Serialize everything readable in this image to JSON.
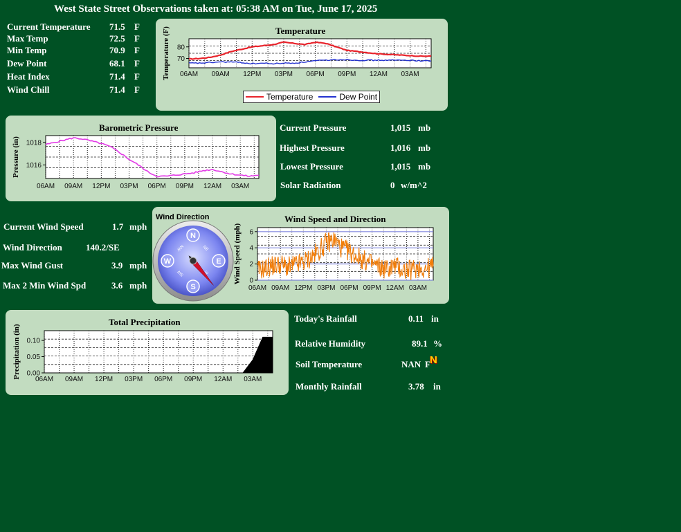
{
  "header": {
    "title": "West State Street Observations taken at: 05:38 AM on Tue, June 17, 2025"
  },
  "temperature_stats": [
    {
      "label": "Current Temperature",
      "value": "71.5",
      "unit": "F"
    },
    {
      "label": "Max Temp",
      "value": "72.5",
      "unit": "F"
    },
    {
      "label": "Min Temp",
      "value": "70.9",
      "unit": "F"
    },
    {
      "label": "Dew Point",
      "value": "68.1",
      "unit": "F"
    },
    {
      "label": "Heat Index",
      "value": "71.4",
      "unit": "F"
    },
    {
      "label": "Wind Chill",
      "value": "71.4",
      "unit": "F"
    }
  ],
  "pressure_stats": [
    {
      "label": "Current Pressure",
      "value": "1,015",
      "unit": "mb"
    },
    {
      "label": "Highest Pressure",
      "value": "1,016",
      "unit": "mb"
    },
    {
      "label": "Lowest Pressure",
      "value": "1,015",
      "unit": "mb"
    },
    {
      "label": "Solar Radiation",
      "value": "0",
      "unit": "w/m^2"
    }
  ],
  "wind_stats": [
    {
      "label": "Current Wind Speed",
      "value": "1.7",
      "unit": "mph"
    },
    {
      "label": "Wind Direction",
      "value": "140.2/SE",
      "unit": ""
    },
    {
      "label": "Max Wind Gust",
      "value": "3.9",
      "unit": "mph"
    },
    {
      "label": "Max 2 Min Wind Spd",
      "value": "3.6",
      "unit": "mph"
    }
  ],
  "misc_stats": [
    {
      "label": "Today's Rainfall",
      "value": "0.11",
      "unit": "in"
    },
    {
      "label": "Relative Humidity",
      "value": "89.1",
      "unit": "%"
    },
    {
      "label": "Soil Temperature",
      "value": "NAN",
      "unit": "F"
    },
    {
      "label": "Monthly Rainfall",
      "value": "3.78",
      "unit": "in"
    }
  ],
  "soil_badge": "N",
  "compass": {
    "title": "Wind Direction",
    "direction_deg": 140.2,
    "cardinals": [
      "N",
      "E",
      "S",
      "W"
    ],
    "intercardinals": [
      "NE",
      "SE",
      "SW",
      "NW"
    ]
  },
  "colors": {
    "background": "#005124",
    "panel": "#c2dcc0",
    "temperature": "#e8242c",
    "dew_point": "#2432d0",
    "pressure": "#e23be6",
    "wind": "#f07d0a",
    "precip": "#000000"
  },
  "time_ticks": [
    "06AM",
    "09AM",
    "12PM",
    "03PM",
    "06PM",
    "09PM",
    "12AM",
    "03AM"
  ],
  "chart_data": [
    {
      "id": "temperature",
      "type": "line",
      "title": "Temperature",
      "ylabel": "Temperature (F)",
      "ylim": [
        62,
        87
      ],
      "yticks": [
        70,
        80
      ],
      "x": [
        "06AM",
        "07AM",
        "08AM",
        "09AM",
        "10AM",
        "11AM",
        "12PM",
        "01PM",
        "02PM",
        "03PM",
        "04PM",
        "05PM",
        "06PM",
        "07PM",
        "08PM",
        "09PM",
        "10PM",
        "11PM",
        "12AM",
        "01AM",
        "02AM",
        "03AM",
        "04AM",
        "05AM"
      ],
      "series": [
        {
          "name": "Temperature",
          "values": [
            69.5,
            70,
            71,
            73,
            76,
            78,
            80,
            81,
            82,
            84,
            83,
            82,
            84,
            83,
            80,
            77,
            76,
            75,
            74,
            73.5,
            73,
            72.5,
            72,
            72
          ]
        },
        {
          "name": "Dew Point",
          "values": [
            66,
            66,
            66.5,
            67,
            67,
            66.5,
            65.5,
            66,
            65.5,
            66,
            66,
            67,
            68,
            68.5,
            69,
            69,
            68.5,
            68.5,
            68.5,
            68.5,
            68.5,
            68.5,
            68,
            68
          ]
        }
      ],
      "legend": "bottom",
      "grid": true
    },
    {
      "id": "pressure",
      "type": "line",
      "title": "Barometric Pressure",
      "ylabel": "Pressure (in)",
      "ylim": [
        1014.8,
        1018.6
      ],
      "yticks": [
        1016,
        1018
      ],
      "x": [
        "06AM",
        "07AM",
        "08AM",
        "09AM",
        "10AM",
        "11AM",
        "12PM",
        "01PM",
        "02PM",
        "03PM",
        "04PM",
        "05PM",
        "06PM",
        "07PM",
        "08PM",
        "09PM",
        "10PM",
        "11PM",
        "12AM",
        "01AM",
        "02AM",
        "03AM",
        "04AM",
        "05AM"
      ],
      "series": [
        {
          "name": "Pressure",
          "values": [
            1017.8,
            1018.0,
            1018.2,
            1018.4,
            1018.3,
            1018.1,
            1017.9,
            1017.6,
            1017.1,
            1016.5,
            1016.0,
            1015.4,
            1015.0,
            1015.0,
            1015.1,
            1015.2,
            1015.3,
            1015.5,
            1015.6,
            1015.4,
            1015.2,
            1015.1,
            1015.0,
            1015.1
          ]
        }
      ],
      "grid": true
    },
    {
      "id": "wind",
      "type": "line",
      "title": "Wind Speed and Direction",
      "ylabel": "Wind Speed (mph)",
      "ylim": [
        0,
        6.5
      ],
      "yticks": [
        0,
        2,
        4,
        6
      ],
      "x": [
        "06AM",
        "07AM",
        "08AM",
        "09AM",
        "10AM",
        "11AM",
        "12PM",
        "01PM",
        "02PM",
        "03PM",
        "04PM",
        "05PM",
        "06PM",
        "07PM",
        "08PM",
        "09PM",
        "10PM",
        "11PM",
        "12AM",
        "01AM",
        "02AM",
        "03AM",
        "04AM",
        "05AM"
      ],
      "series": [
        {
          "name": "Wind Speed",
          "values": [
            1.2,
            1.5,
            1.8,
            2.0,
            1.6,
            1.9,
            2.2,
            2.8,
            3.6,
            4.6,
            5.0,
            4.0,
            3.5,
            3.0,
            2.4,
            2.0,
            1.6,
            1.4,
            1.8,
            1.3,
            1.2,
            1.6,
            1.4,
            1.7
          ]
        }
      ],
      "grid": true
    },
    {
      "id": "precip",
      "type": "area",
      "title": "Total Precipitation",
      "ylabel": "Precipitation (in)",
      "ylim": [
        0,
        0.13
      ],
      "yticks": [
        0.0,
        0.05,
        0.1
      ],
      "ytick_labels": [
        "0.00",
        "0.05",
        "0.10"
      ],
      "x": [
        "06AM",
        "07AM",
        "08AM",
        "09AM",
        "10AM",
        "11AM",
        "12PM",
        "01PM",
        "02PM",
        "03PM",
        "04PM",
        "05PM",
        "06PM",
        "07PM",
        "08PM",
        "09PM",
        "10PM",
        "11PM",
        "12AM",
        "01AM",
        "02AM",
        "03AM",
        "04AM",
        "05AM"
      ],
      "series": [
        {
          "name": "Precipitation",
          "values": [
            0,
            0,
            0,
            0,
            0,
            0,
            0,
            0,
            0,
            0,
            0,
            0,
            0,
            0,
            0,
            0,
            0,
            0,
            0,
            0,
            0,
            0.04,
            0.11,
            0.11
          ]
        }
      ],
      "grid": true
    }
  ]
}
